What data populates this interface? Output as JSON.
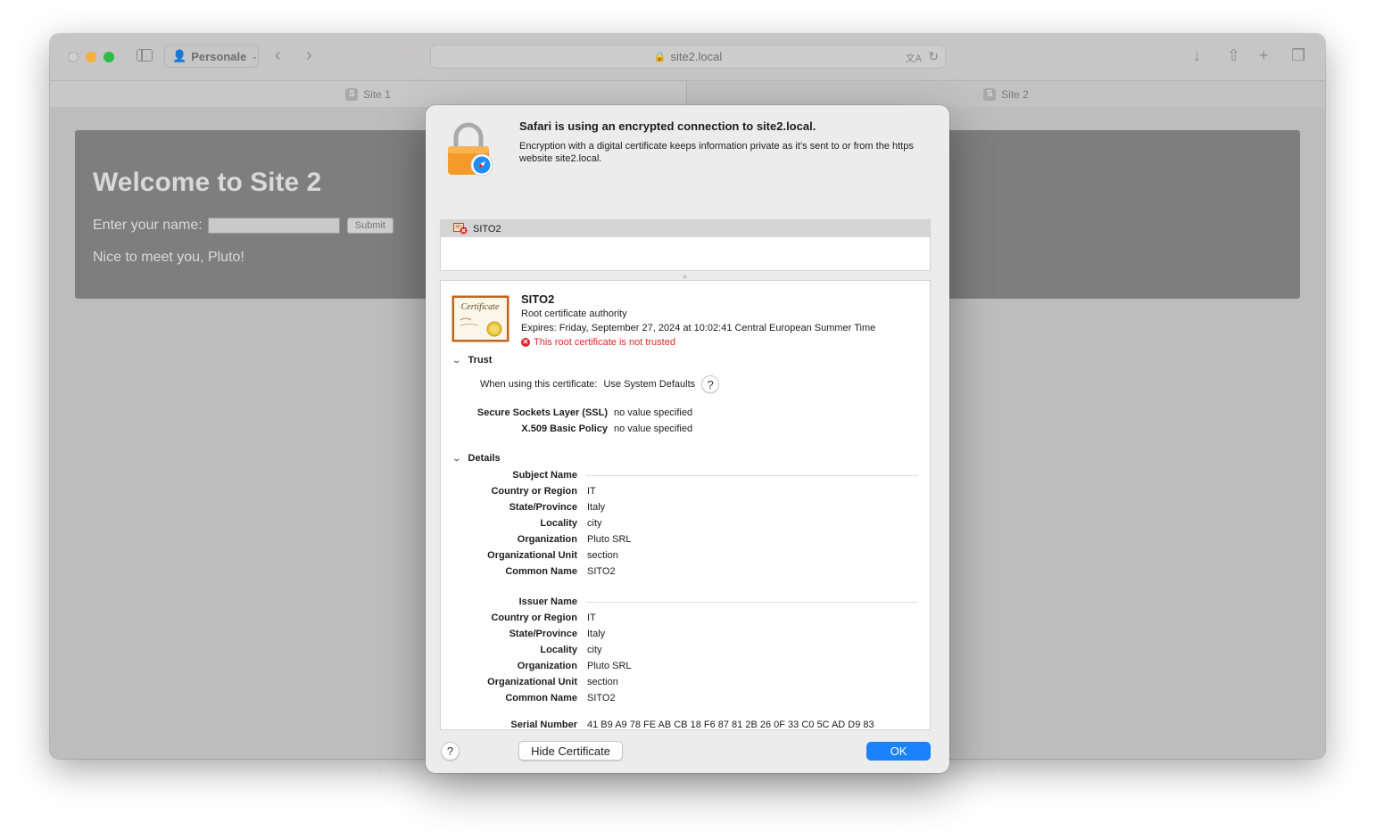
{
  "browser": {
    "profile_label": "Personale",
    "address": "site2.local",
    "tabs": [
      {
        "label": "Site 1",
        "favicon": "S"
      },
      {
        "label": "Site 2",
        "favicon": "S"
      }
    ]
  },
  "page": {
    "heading": "Welcome to Site 2",
    "name_label": "Enter your name:",
    "submit_label": "Submit",
    "greeting": "Nice to meet you, Pluto!"
  },
  "dialog": {
    "title": "Safari is using an encrypted connection to site2.local.",
    "description": "Encryption with a digital certificate keeps information private as it’s sent to or from the https website site2.local.",
    "cert_list": [
      {
        "name": "SITO2"
      }
    ],
    "cert": {
      "name": "SITO2",
      "type": "Root certificate authority",
      "expires": "Expires: Friday, September 27, 2024 at 10:02:41 Central European Summer Time",
      "status": "This root certificate is not trusted",
      "image_text": "Certificate"
    },
    "trust": {
      "header": "Trust",
      "when_using_label": "When using this certificate:",
      "when_using_value": "Use System Defaults",
      "ssl_label": "Secure Sockets Layer (SSL)",
      "ssl_value": "no value specified",
      "x509_label": "X.509 Basic Policy",
      "x509_value": "no value specified"
    },
    "details": {
      "header": "Details",
      "subject_header": "Subject Name",
      "subject": [
        {
          "k": "Country or Region",
          "v": "IT"
        },
        {
          "k": "State/Province",
          "v": "Italy"
        },
        {
          "k": "Locality",
          "v": "city"
        },
        {
          "k": "Organization",
          "v": "Pluto SRL"
        },
        {
          "k": "Organizational Unit",
          "v": "section"
        },
        {
          "k": "Common Name",
          "v": "SITO2"
        }
      ],
      "issuer_header": "Issuer Name",
      "issuer": [
        {
          "k": "Country or Region",
          "v": "IT"
        },
        {
          "k": "State/Province",
          "v": "Italy"
        },
        {
          "k": "Locality",
          "v": "city"
        },
        {
          "k": "Organization",
          "v": "Pluto SRL"
        },
        {
          "k": "Organizational Unit",
          "v": "section"
        },
        {
          "k": "Common Name",
          "v": "SITO2"
        }
      ],
      "serial_label": "Serial Number",
      "serial_value": "41 B9 A9 78 FE AB CB 18 F6 87 81 2B 26 0F 33 C0 5C AD D9 83"
    },
    "help_label": "?",
    "hide_button": "Hide Certificate",
    "ok_button": "OK"
  },
  "colors": {
    "accent": "#1a82fb",
    "error": "#e0272b",
    "traffic_min": "#f6b03a",
    "traffic_max": "#2fbb48"
  }
}
